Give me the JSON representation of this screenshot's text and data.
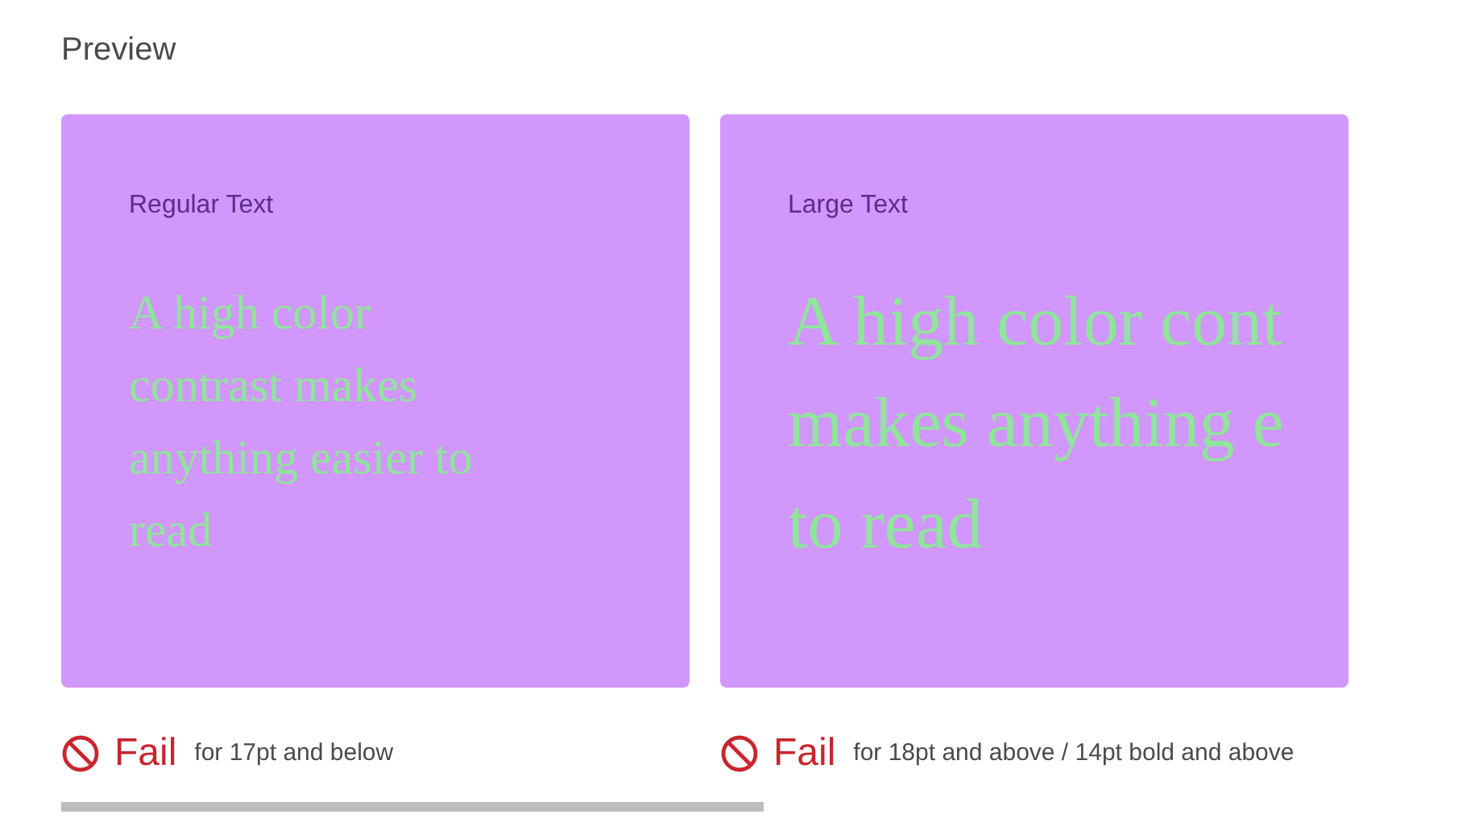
{
  "title": "Preview",
  "previews": [
    {
      "label": "Regular Text",
      "kind": "regular",
      "lines": [
        "A high color",
        "contrast makes",
        "anything easier to",
        "read"
      ],
      "result": {
        "kind": "fail",
        "word": "Fail",
        "note": "for 17pt and below"
      }
    },
    {
      "label": "Large Text",
      "kind": "large",
      "lines": [
        "A high color cont",
        "makes anything e",
        "to read"
      ],
      "result": {
        "kind": "fail",
        "word": "Fail",
        "note": "for 18pt and above / 14pt bold and above"
      }
    }
  ]
}
